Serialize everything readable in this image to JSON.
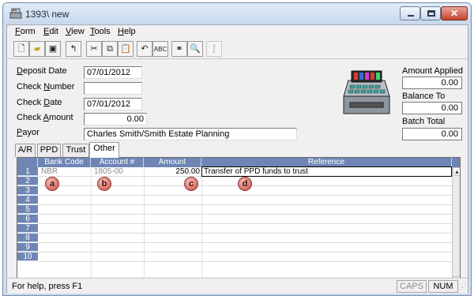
{
  "window": {
    "title": "1393\\ new"
  },
  "menu": [
    {
      "key": "F",
      "rest": "orm"
    },
    {
      "key": "E",
      "rest": "dit"
    },
    {
      "key": "V",
      "rest": "iew"
    },
    {
      "key": "T",
      "rest": "ools"
    },
    {
      "key": "H",
      "rest": "elp"
    }
  ],
  "form": {
    "deposit_date": {
      "label_key": "D",
      "label_rest": "eposit Date",
      "value": "07/01/2012"
    },
    "check_number": {
      "label_pre": "Check ",
      "label_key": "N",
      "label_rest": "umber",
      "value": ""
    },
    "check_date": {
      "label_pre": "Check ",
      "label_key": "D",
      "label_rest": "ate",
      "value": "07/01/2012"
    },
    "check_amount": {
      "label_pre": "Check ",
      "label_key": "A",
      "label_rest": "mount",
      "value": "0.00"
    },
    "payor": {
      "label_key": "P",
      "label_rest": "ayor",
      "value": "Charles Smith/Smith Estate Planning"
    }
  },
  "summary": {
    "amount_applied": {
      "label": "Amount Applied",
      "value": "0.00"
    },
    "balance_to_apply": {
      "label": "Balance To Apply",
      "value": "0.00"
    },
    "batch_total": {
      "label": "Batch Total",
      "value": "0.00"
    }
  },
  "tabs": [
    "A/R",
    "PPD",
    "Trust",
    "Other"
  ],
  "active_tab": "Other",
  "grid": {
    "columns": [
      "Bank Code",
      "Account #",
      "Amount",
      "Reference"
    ],
    "row_numbers": [
      "1",
      "2",
      "3",
      "4",
      "5",
      "6",
      "7",
      "8",
      "9",
      "10"
    ],
    "rows": [
      {
        "bank_code": "NBR",
        "account": "1805-00",
        "amount": "250.00",
        "reference": "Transfer of PPD funds to trust"
      }
    ]
  },
  "callouts": [
    "a",
    "b",
    "c",
    "d"
  ],
  "status": {
    "help_text": "For help, press F1",
    "caps": "CAPS",
    "num": "NUM"
  },
  "colors": {
    "grid_header": "#6f86b5",
    "callout": "#d96a5e",
    "titlebar": "#cfdeef"
  }
}
